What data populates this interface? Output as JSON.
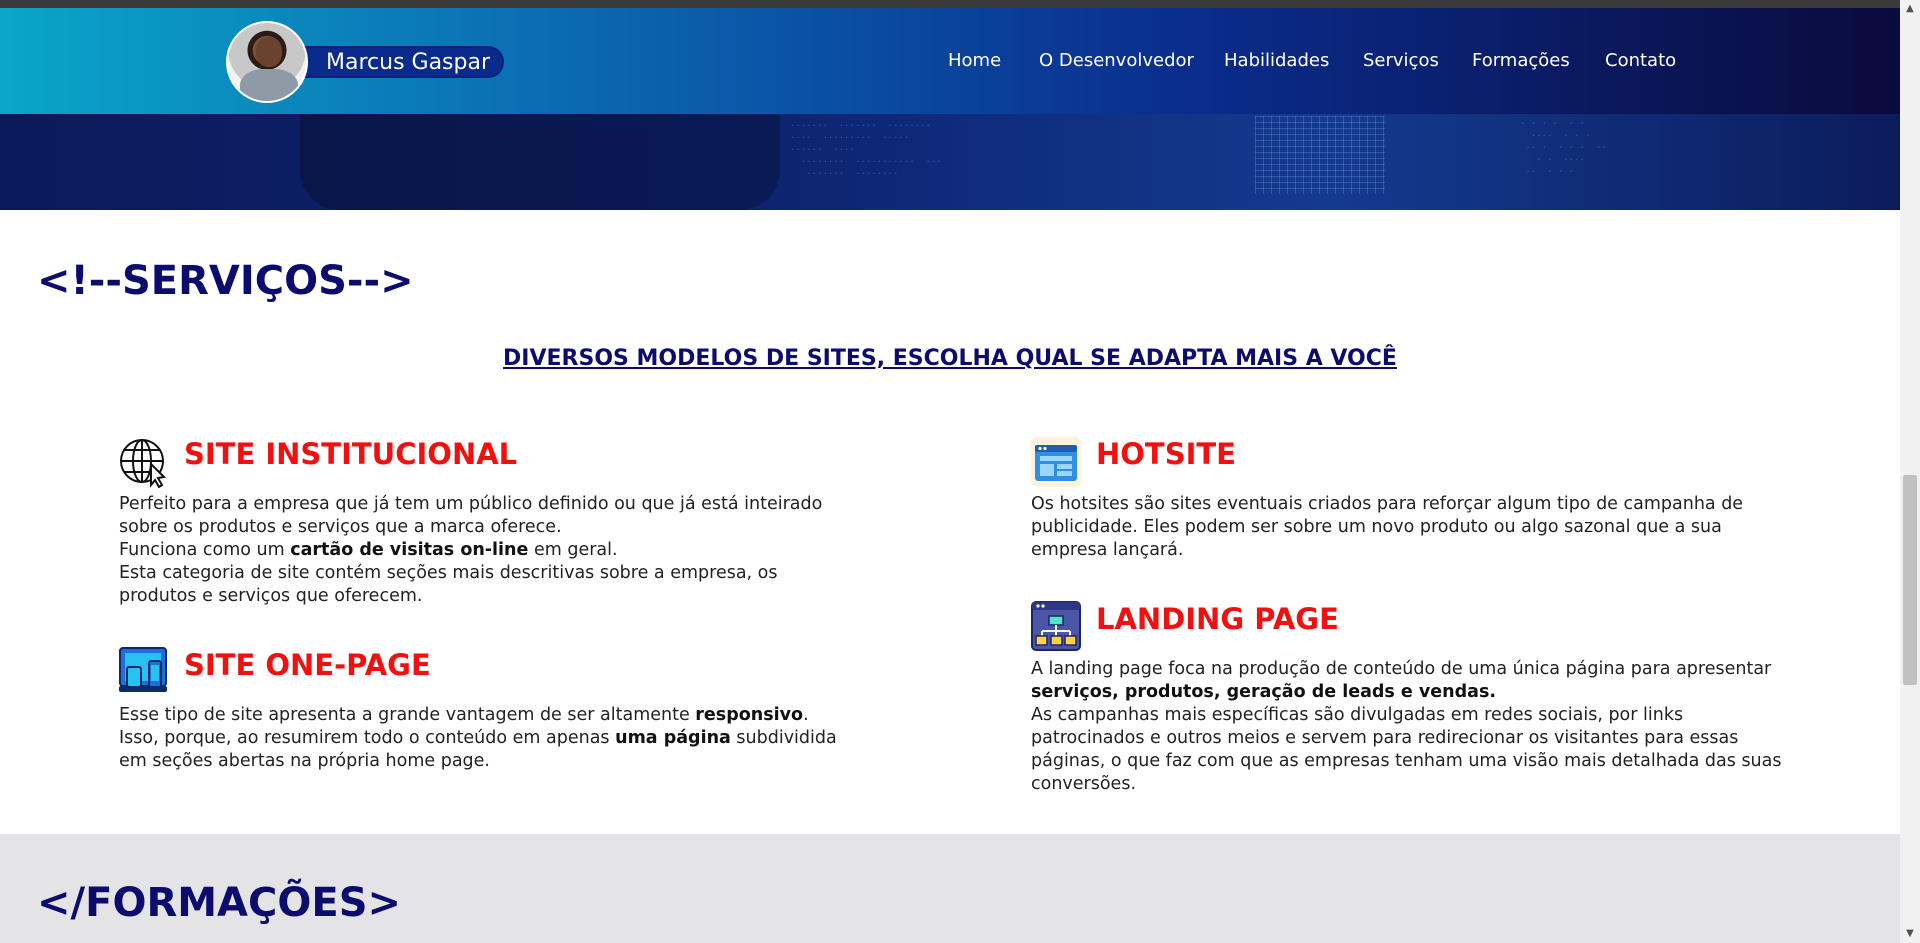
{
  "header": {
    "brand_name": "Marcus Gaspar",
    "nav": [
      "Home",
      "O Desenvolvedor",
      "Habilidades",
      "Serviços",
      "Formações",
      "Contato"
    ]
  },
  "services": {
    "title": "<!--SERVIÇOS-->",
    "subtitle": "DIVERSOS MODELOS DE SITES, ESCOLHA QUAL SE ADAPTA MAIS A VOCÊ",
    "cards": [
      {
        "title": "SITE INSTITUCIONAL",
        "icon": "globe-cursor-icon",
        "text_1": "Perfeito para a empresa que já tem um público definido ou que já está inteirado sobre os produtos e serviços que a marca oferece.",
        "text_2_pre": "Funciona como um ",
        "text_2_bold": "cartão de visitas on-line",
        "text_2_post": " em geral.",
        "text_3": "Esta categoria de site contém seções mais descritivas sobre a empresa, os produtos e serviços que oferecem."
      },
      {
        "title": "SITE ONE-PAGE",
        "icon": "responsive-devices-icon",
        "text_1_pre": "Esse tipo de site apresenta a grande vantagem de ser altamente ",
        "text_1_bold": "responsivo",
        "text_1_post": ".",
        "text_2_pre": "Isso, porque, ao resumirem todo o conteúdo em apenas ",
        "text_2_bold": "uma página",
        "text_2_post": " subdividida em seções abertas na própria home page."
      },
      {
        "title": "HOTSITE",
        "icon": "browser-window-icon",
        "text_1": "Os hotsites são sites eventuais criados para reforçar algum tipo de campanha de publicidade. Eles podem ser sobre um novo produto ou algo sazonal que a sua empresa lançará."
      },
      {
        "title": "LANDING PAGE",
        "icon": "sitemap-icon",
        "text_1_pre": "A landing page foca na produção de conteúdo de uma única página para apresentar ",
        "text_1_bold": "serviços, produtos, geração de leads e vendas.",
        "text_2": "As campanhas mais específicas são divulgadas em redes sociais, por links patrocinados e outros meios e servem para redirecionar os visitantes para essas páginas, o que faz com que as empresas tenham uma visão mais detalhada das suas conversões."
      }
    ]
  },
  "formacoes": {
    "title": "</FORMAÇÕES>"
  },
  "colors": {
    "accent_red": "#f10f0f",
    "navy": "#0c0c6e"
  }
}
